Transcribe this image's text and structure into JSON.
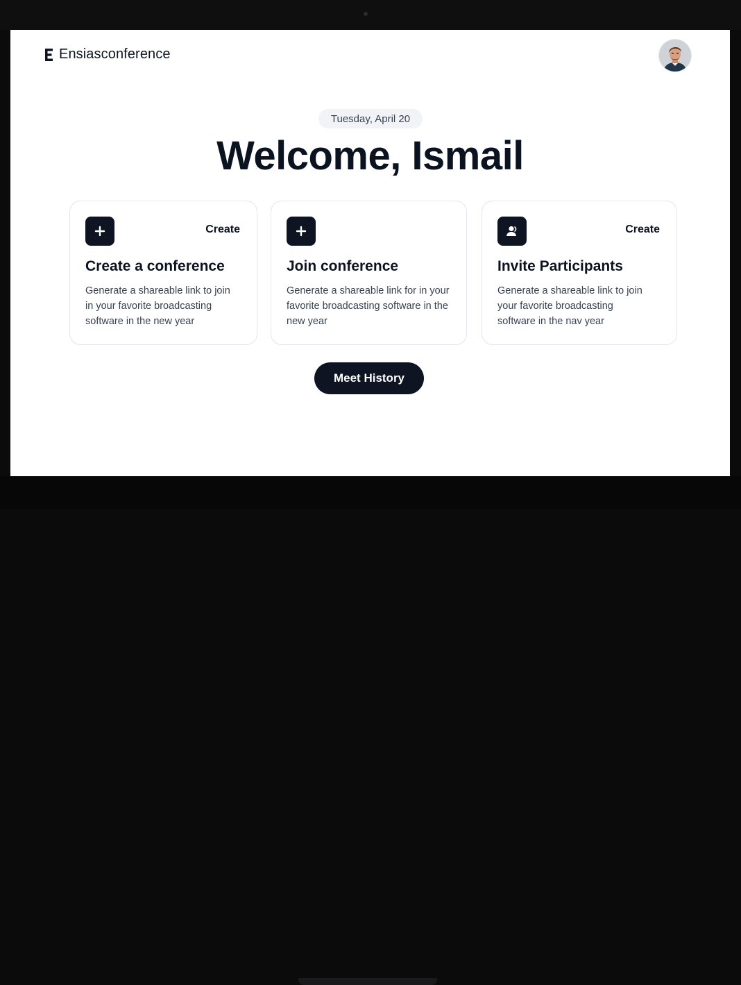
{
  "app": {
    "name": "Ensiasconference"
  },
  "header": {
    "avatar_icon": "user-avatar-photo"
  },
  "hero": {
    "date": "Tuesday, April 20",
    "welcome": "Welcome, Ismail"
  },
  "cards": [
    {
      "icon": "plus-icon",
      "action": "Create",
      "title": "Create a conference",
      "description": "Generate a shareable link to join in your favorite broadcasting software in the new year"
    },
    {
      "icon": "plus-icon",
      "action": "",
      "title": "Join conference",
      "description": "Generate a shareable link for in your favorite broadcasting software in the new year"
    },
    {
      "icon": "user-add-icon",
      "action": "Create",
      "title": "Invite Participants",
      "description": "Generate a shareable link to join your favorite broadcasting software in the nav year"
    }
  ],
  "footer": {
    "history_label": "Meet History"
  },
  "colors": {
    "primary": "#0f1422",
    "background": "#ffffff",
    "card_border": "#e4e6eb",
    "date_pill": "#f1f3f6"
  }
}
